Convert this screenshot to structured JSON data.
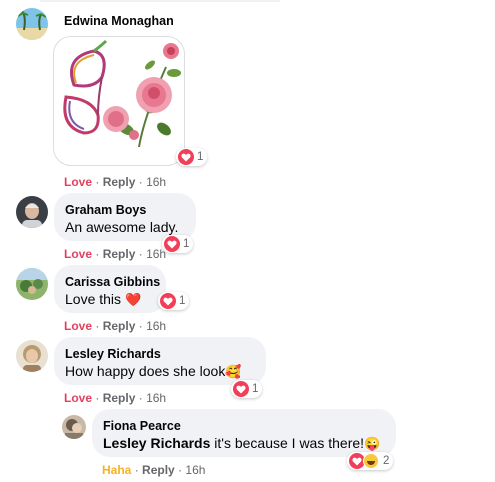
{
  "colors": {
    "love": "#e4405f",
    "haha": "#f7b125",
    "bubble": "#f0f2f5",
    "meta": "#65676b"
  },
  "comments": [
    {
      "author": "Edwina Monaghan",
      "attachment": "rose-butterfly-sticker",
      "reaction_count": "1",
      "action_love": "Love",
      "action_reply": "Reply",
      "time": "16h"
    },
    {
      "author": "Graham Boys",
      "text": "An awesome lady.",
      "reaction_count": "1",
      "action_love": "Love",
      "action_reply": "Reply",
      "time": "16h"
    },
    {
      "author": "Carissa Gibbins",
      "text": "Love this",
      "text_emoji": "❤️",
      "reaction_count": "1",
      "action_love": "Love",
      "action_reply": "Reply",
      "time": "16h"
    },
    {
      "author": "Lesley Richards",
      "text": "How happy does she look",
      "text_emoji": "🥰",
      "reaction_count": "1",
      "action_love": "Love",
      "action_reply": "Reply",
      "time": "16h"
    }
  ],
  "reply": {
    "author": "Fiona Pearce",
    "mention": "Lesley Richards",
    "text": " it's because I was there!",
    "text_emoji": "😜",
    "reaction_count": "2",
    "action_haha": "Haha",
    "action_reply": "Reply",
    "time": "16h"
  }
}
